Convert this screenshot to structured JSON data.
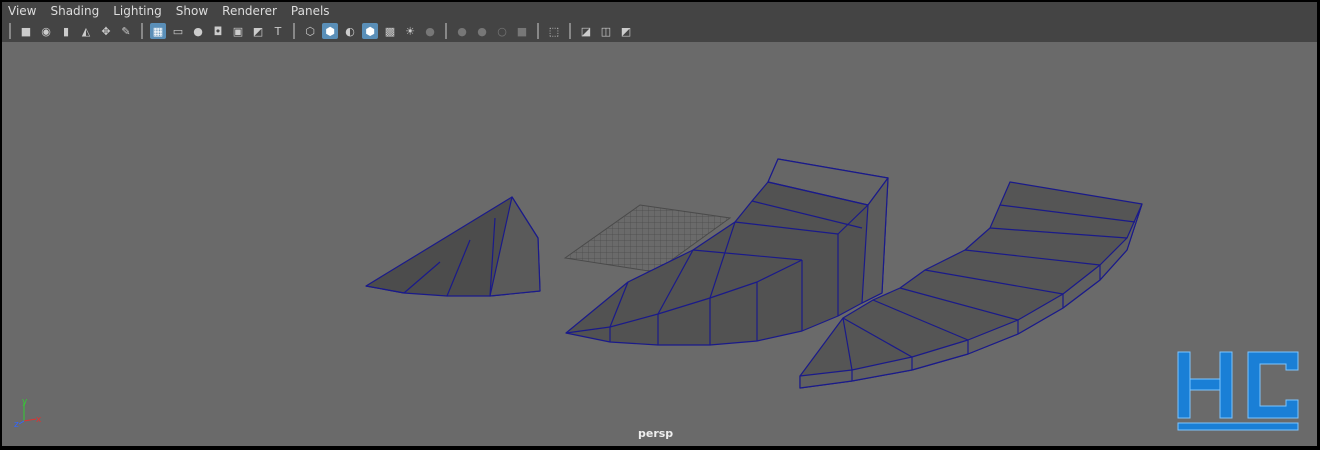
{
  "menu": [
    "View",
    "Shading",
    "Lighting",
    "Show",
    "Renderer",
    "Panels"
  ],
  "toolbar_icons": [
    {
      "name": "camera-icon",
      "glyph": "■",
      "on": false
    },
    {
      "name": "camera-attributes-icon",
      "glyph": "◉",
      "on": false
    },
    {
      "name": "bookmark-icon",
      "glyph": "▮",
      "on": false
    },
    {
      "name": "image-plane-icon",
      "glyph": "◭",
      "on": false
    },
    {
      "name": "2d-pan-zoom-icon",
      "glyph": "✥",
      "on": false
    },
    {
      "name": "grease-pencil-icon",
      "glyph": "✎",
      "on": false
    },
    {
      "sep": true
    },
    {
      "name": "grid-icon",
      "glyph": "▦",
      "on": true
    },
    {
      "name": "film-gate-icon",
      "glyph": "▭",
      "on": false
    },
    {
      "name": "resolution-gate-icon",
      "glyph": "●",
      "on": false
    },
    {
      "name": "gate-mask-icon",
      "glyph": "◘",
      "on": false
    },
    {
      "name": "field-chart-icon",
      "glyph": "▣",
      "on": false
    },
    {
      "name": "safe-action-icon",
      "glyph": "◩",
      "on": false
    },
    {
      "name": "safe-title-icon",
      "glyph": "T",
      "on": false
    },
    {
      "sep": true
    },
    {
      "name": "wireframe-icon",
      "glyph": "⬡",
      "on": false
    },
    {
      "name": "smooth-shade-icon",
      "glyph": "⬢",
      "on": true
    },
    {
      "name": "default-material-icon",
      "glyph": "◐",
      "on": false
    },
    {
      "name": "wireframe-on-shaded-icon",
      "glyph": "⬢",
      "on": true
    },
    {
      "name": "textured-icon",
      "glyph": "▩",
      "on": false
    },
    {
      "name": "lights-icon",
      "glyph": "☀",
      "on": false
    },
    {
      "name": "shadows-icon",
      "glyph": "●",
      "on": false,
      "dim": true
    },
    {
      "sep": true
    },
    {
      "name": "ambient-occlusion-icon",
      "glyph": "●",
      "on": false,
      "dim": true
    },
    {
      "name": "motion-blur-icon",
      "glyph": "●",
      "on": false,
      "dim": true
    },
    {
      "name": "anti-aliasing-icon",
      "glyph": "○",
      "on": false,
      "dim": true
    },
    {
      "name": "depth-of-field-icon",
      "glyph": "■",
      "on": false,
      "dim": true
    },
    {
      "sep": true
    },
    {
      "name": "isolate-select-icon",
      "glyph": "⬚",
      "on": false
    },
    {
      "sep": true
    },
    {
      "name": "xray-icon",
      "glyph": "◪",
      "on": false
    },
    {
      "name": "xray-active-icon",
      "glyph": "◫",
      "on": false
    },
    {
      "name": "xray-joints-icon",
      "glyph": "◩",
      "on": false
    }
  ],
  "viewport": {
    "camera_label": "persp",
    "axis": {
      "x": "x",
      "y": "y",
      "z": "z"
    },
    "logo": "HC"
  }
}
